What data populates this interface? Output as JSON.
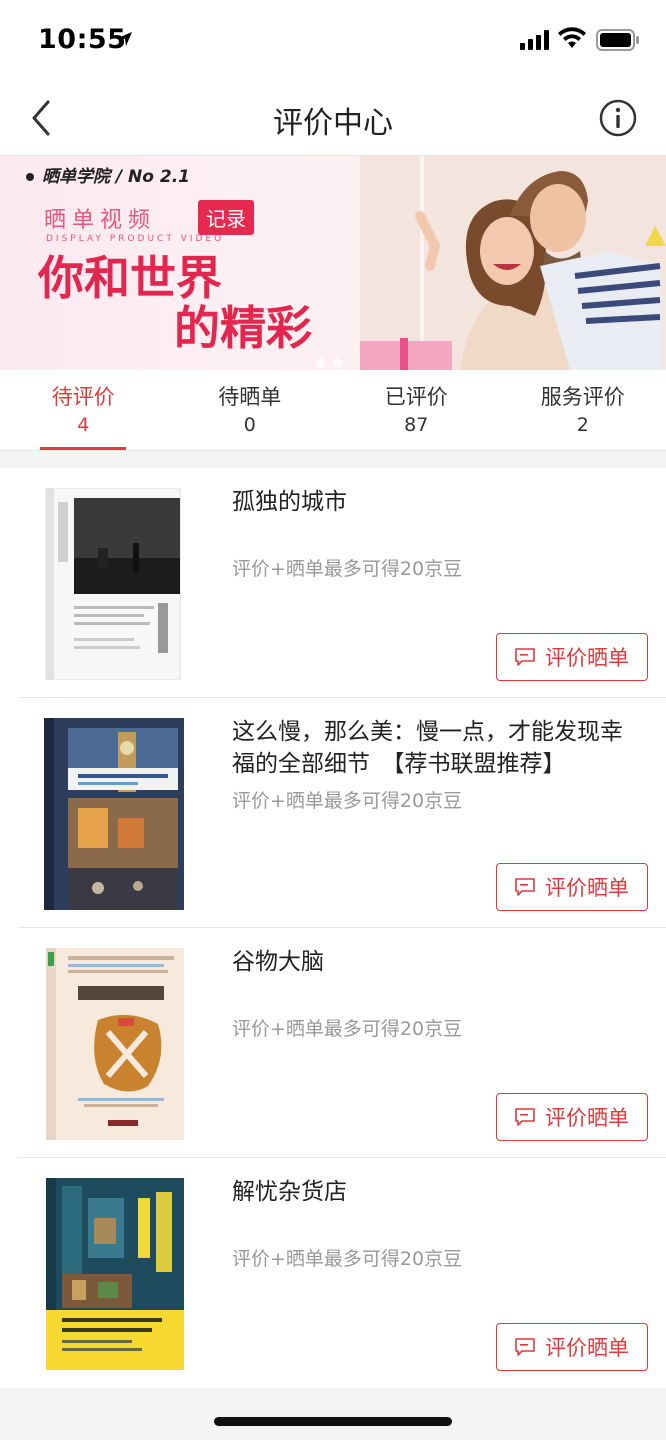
{
  "status": {
    "time": "10:55"
  },
  "nav": {
    "title": "评价中心"
  },
  "banner": {
    "brand": "晒单学院",
    "issue": "No 2.1",
    "subtitle": "晒单视频",
    "tag": "记录",
    "english": "DISPLAY PRODUCT VIDEO",
    "line1": "你和世界",
    "line2": "的精彩"
  },
  "tabs": [
    {
      "label": "待评价",
      "count": "4",
      "active": true
    },
    {
      "label": "待晒单",
      "count": "0",
      "active": false
    },
    {
      "label": "已评价",
      "count": "87",
      "active": false
    },
    {
      "label": "服务评价",
      "count": "2",
      "active": false
    }
  ],
  "items": [
    {
      "title": "孤独的城市",
      "subtitle": "评价+晒单最多可得20京豆",
      "button": "评价晒单"
    },
    {
      "title": "这么慢，那么美：慢一点，才能发现幸福的全部细节　【荐书联盟推荐】",
      "subtitle": "评价+晒单最多可得20京豆",
      "button": "评价晒单"
    },
    {
      "title": "谷物大脑",
      "subtitle": "评价+晒单最多可得20京豆",
      "button": "评价晒单"
    },
    {
      "title": "解忧杂货店",
      "subtitle": "评价+晒单最多可得20京豆",
      "button": "评价晒单"
    }
  ],
  "colors": {
    "accent": "#e4393c",
    "banner_text": "#e3264e"
  }
}
